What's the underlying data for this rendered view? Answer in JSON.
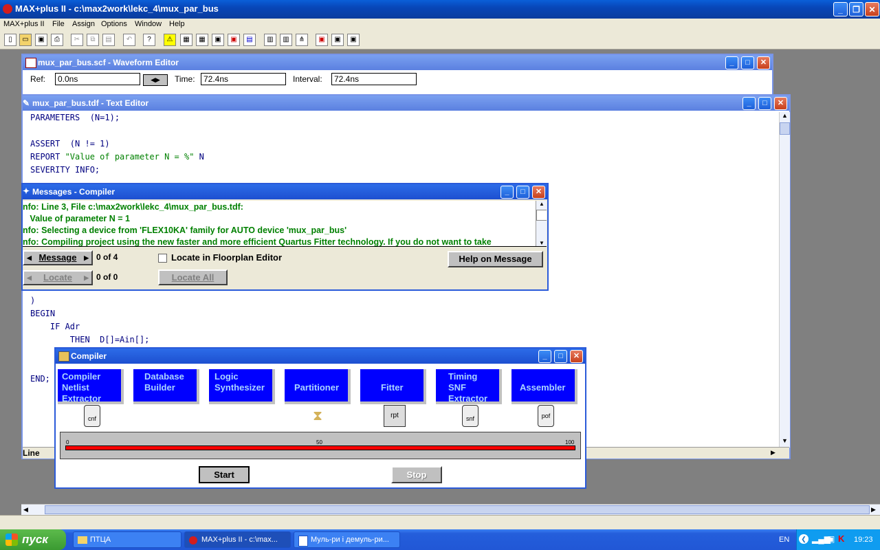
{
  "app": {
    "title": "MAX+plus II - c:\\max2work\\lekc_4\\mux_par_bus",
    "menu": [
      "MAX+plus II",
      "File",
      "Assign",
      "Options",
      "Window",
      "Help"
    ]
  },
  "waveform": {
    "title": "mux_par_bus.scf - Waveform Editor",
    "ref_label": "Ref:",
    "ref_value": "0.0ns",
    "time_label": "Time:",
    "time_value": "72.4ns",
    "interval_label": "Interval:",
    "interval_value": "72.4ns"
  },
  "text_editor": {
    "title": "mux_par_bus.tdf - Text Editor",
    "status": "Line",
    "lines": {
      "l1": "PARAMETERS  (N=1);",
      "l2a": "ASSERT  (N != 1)",
      "l3a": "REPORT ",
      "l3b": "\"Value of parameter N = %\"",
      "l3c": " N",
      "l4": "SEVERITY INFO;",
      "l5": ")",
      "l6": "BEGIN",
      "l7": "    IF Adr",
      "l8": "        THEN  D[]=Ain[];",
      "l9": "END;"
    }
  },
  "messages": {
    "title": "Messages - Compiler",
    "lines": [
      "nfo: Line 3, File c:\\max2work\\lekc_4\\mux_par_bus.tdf:",
      "   Value of parameter N = 1",
      "nfo: Selecting a device from 'FLEX10KA' family for AUTO device 'mux_par_bus'",
      "nfo: Compiling project using the new faster and more efficient Quartus Fitter technology. If you do not want to take"
    ],
    "message_btn": "Message",
    "message_count": "0 of 4",
    "locate_btn": "Locate",
    "locate_count": "0 of 0",
    "locate_floorplan": "Locate in Floorplan Editor",
    "locate_all": "Locate All",
    "help_btn": "Help on Message"
  },
  "compiler": {
    "title": "Compiler",
    "stages": [
      {
        "label": "Compiler\nNetlist\nExtractor"
      },
      {
        "label": "Database\nBuilder"
      },
      {
        "label": "Logic\nSynthesizer"
      },
      {
        "label": "Partitioner"
      },
      {
        "label": "Fitter"
      },
      {
        "label": "Timing\nSNF\nExtractor"
      },
      {
        "label": "Assembler"
      }
    ],
    "icons": {
      "cnf": "cnf",
      "rpt": "rpt",
      "snf": "snf",
      "pof": "pof"
    },
    "progress": {
      "min": "0",
      "mid": "50",
      "max": "100",
      "value": 100
    },
    "start": "Start",
    "stop": "Stop"
  },
  "taskbar": {
    "start": "пуск",
    "items": [
      "ПТЦА",
      "MAX+plus II - c:\\max...",
      "Муль-ри і демуль-ри..."
    ],
    "lang": "EN",
    "clock": "19:23"
  },
  "colors": {
    "accent": "#0000ff",
    "progress": "#ff0000",
    "message_text": "#008000"
  }
}
